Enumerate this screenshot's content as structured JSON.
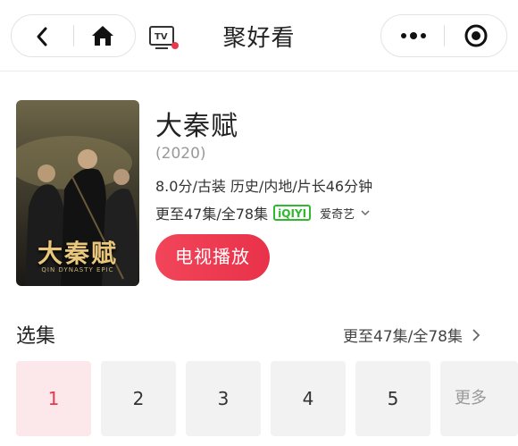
{
  "header": {
    "title": "聚好看"
  },
  "show": {
    "poster_title": "大秦赋",
    "poster_subtitle": "QIN DYNASTY EPIC",
    "name": "大秦赋",
    "year": "(2020)",
    "meta": "8.0分/古装 历史/内地/片长46分钟",
    "progress": "更至47集/全78集",
    "platform_logo": "iQIYI",
    "platform": "爱奇艺",
    "play_button": "电视播放"
  },
  "episodes": {
    "title": "选集",
    "count": "更至47集/全78集",
    "items": [
      "1",
      "2",
      "3",
      "4",
      "5"
    ],
    "more_label": "更多",
    "selected": "1"
  },
  "colors": {
    "accent": "#e8384e",
    "selected_bg": "#fce8ea",
    "tile_bg": "#f2f2f2",
    "iqiyi_green": "#2fb92f"
  },
  "icons": [
    "back-icon",
    "home-icon",
    "tv-icon",
    "more-dots-icon",
    "target-icon",
    "chevron-down-icon",
    "chevron-right-icon"
  ]
}
